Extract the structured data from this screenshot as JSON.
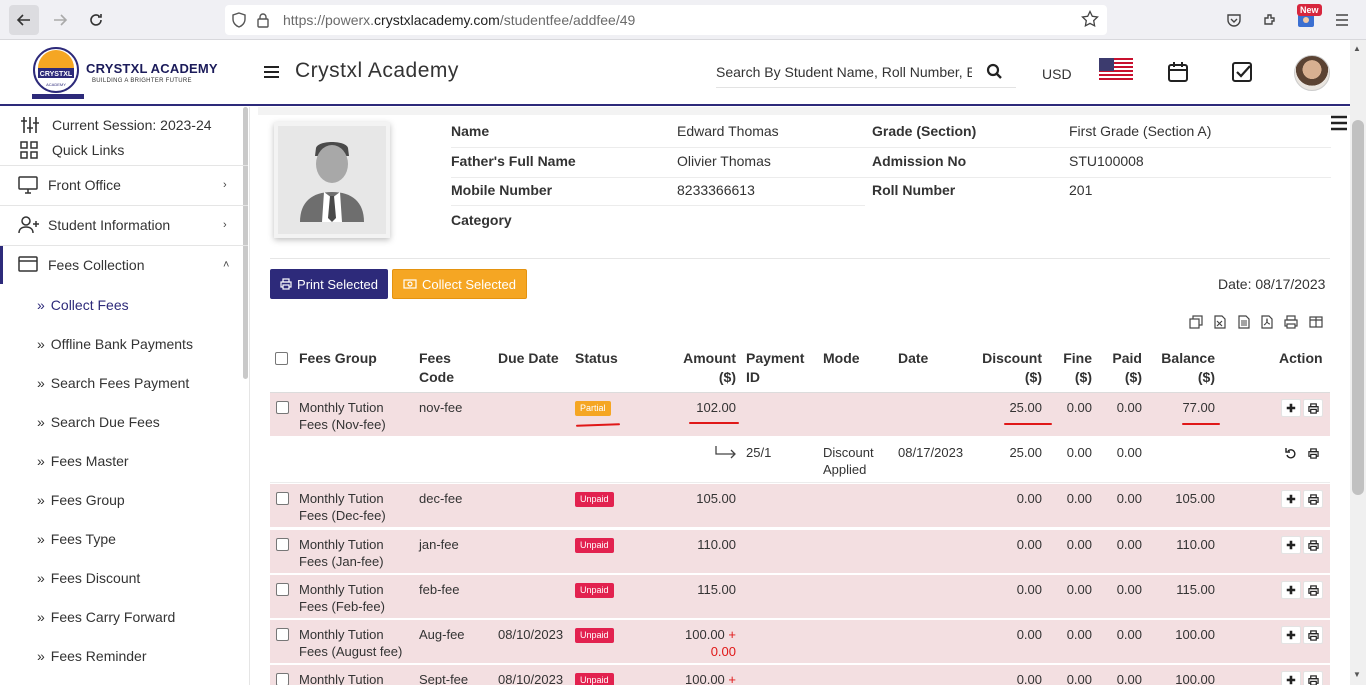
{
  "browser": {
    "url_prefix": "https://powerx.",
    "url_domain": "crystxlacademy.com",
    "url_path": "/studentfee/addfee/49",
    "new_badge": "New"
  },
  "header": {
    "logo_title": "CRYSTXL ACADEMY",
    "logo_sub": "BUILDING A BRIGHTER FUTURE",
    "logo_badge": "CRYSTXL",
    "logo_badge_sub": "ACADEMY",
    "brand": "Crystxl Academy",
    "search_placeholder": "Search By Student Name, Roll Number, Enroll Number, National Id, Local Id Etc.",
    "currency": "USD"
  },
  "sidebar": {
    "session": "Current Session: 2023-24",
    "quick_links": "Quick Links",
    "menus": [
      {
        "label": "Front Office"
      },
      {
        "label": "Student Information"
      },
      {
        "label": "Fees Collection"
      }
    ],
    "sub_items": [
      "Collect Fees",
      "Offline Bank Payments",
      "Search Fees Payment",
      "Search Due Fees",
      "Fees Master",
      "Fees Group",
      "Fees Type",
      "Fees Discount",
      "Fees Carry Forward",
      "Fees Reminder"
    ]
  },
  "student": {
    "name_label": "Name",
    "name": "Edward Thomas",
    "father_label": "Father's Full Name",
    "father": "Olivier Thomas",
    "mobile_label": "Mobile Number",
    "mobile": "8233366613",
    "category_label": "Category",
    "grade_label": "Grade (Section)",
    "grade": "First Grade (Section A)",
    "admission_label": "Admission No",
    "admission": "STU100008",
    "roll_label": "Roll Number",
    "roll": "201"
  },
  "actions": {
    "print_selected": "Print Selected",
    "collect_selected": "Collect Selected",
    "date": "Date: 08/17/2023"
  },
  "table": {
    "headers": {
      "group": "Fees Group",
      "code_1": "Fees",
      "code_2": "Code",
      "due": "Due Date",
      "status": "Status",
      "amount_1": "Amount",
      "amount_2": "($)",
      "pid_1": "Payment",
      "pid_2": "ID",
      "mode": "Mode",
      "date": "Date",
      "discount_1": "Discount",
      "discount_2": "($)",
      "fine_1": "Fine",
      "fine_2": "($)",
      "paid_1": "Paid",
      "paid_2": "($)",
      "balance_1": "Balance",
      "balance_2": "($)",
      "action": "Action"
    },
    "rows": [
      {
        "group_1": "Monthly Tution",
        "group_2": "Fees (Nov-fee)",
        "code": "nov-fee",
        "due": "",
        "status": "Partial",
        "amount": "102.00",
        "discount": "25.00",
        "fine": "0.00",
        "paid": "0.00",
        "balance": "77.00"
      },
      {
        "pid": "25/1",
        "mode_1": "Discount",
        "mode_2": "Applied",
        "date": "08/17/2023",
        "discount": "25.00",
        "fine": "0.00",
        "paid": "0.00"
      },
      {
        "group_1": "Monthly Tution",
        "group_2": "Fees (Dec-fee)",
        "code": "dec-fee",
        "due": "",
        "status": "Unpaid",
        "amount": "105.00",
        "discount": "0.00",
        "fine": "0.00",
        "paid": "0.00",
        "balance": "105.00"
      },
      {
        "group_1": "Monthly Tution",
        "group_2": "Fees (Jan-fee)",
        "code": "jan-fee",
        "due": "",
        "status": "Unpaid",
        "amount": "110.00",
        "discount": "0.00",
        "fine": "0.00",
        "paid": "0.00",
        "balance": "110.00"
      },
      {
        "group_1": "Monthly Tution",
        "group_2": "Fees (Feb-fee)",
        "code": "feb-fee",
        "due": "",
        "status": "Unpaid",
        "amount": "115.00",
        "discount": "0.00",
        "fine": "0.00",
        "paid": "0.00",
        "balance": "115.00"
      },
      {
        "group_1": "Monthly Tution",
        "group_2": "Fees (August fee)",
        "code": "Aug-fee",
        "due": "08/10/2023",
        "status": "Unpaid",
        "amount": "100.00",
        "amount_plus": "+",
        "amount_fine": "0.00",
        "discount": "0.00",
        "fine": "0.00",
        "paid": "0.00",
        "balance": "100.00"
      },
      {
        "group_1": "Monthly Tution",
        "code": "Sept-fee",
        "due": "08/10/2023",
        "status": "Unpaid",
        "amount": "100.00",
        "amount_plus": "+",
        "discount": "0.00",
        "fine": "0.00",
        "paid": "0.00",
        "balance": "100.00"
      }
    ]
  },
  "colors": {
    "primary": "#2d2a7a",
    "accent": "#f5a623",
    "unpaid": "#e2224f",
    "row_pink": "#f3dfe1",
    "annotation_red": "#e01818"
  }
}
